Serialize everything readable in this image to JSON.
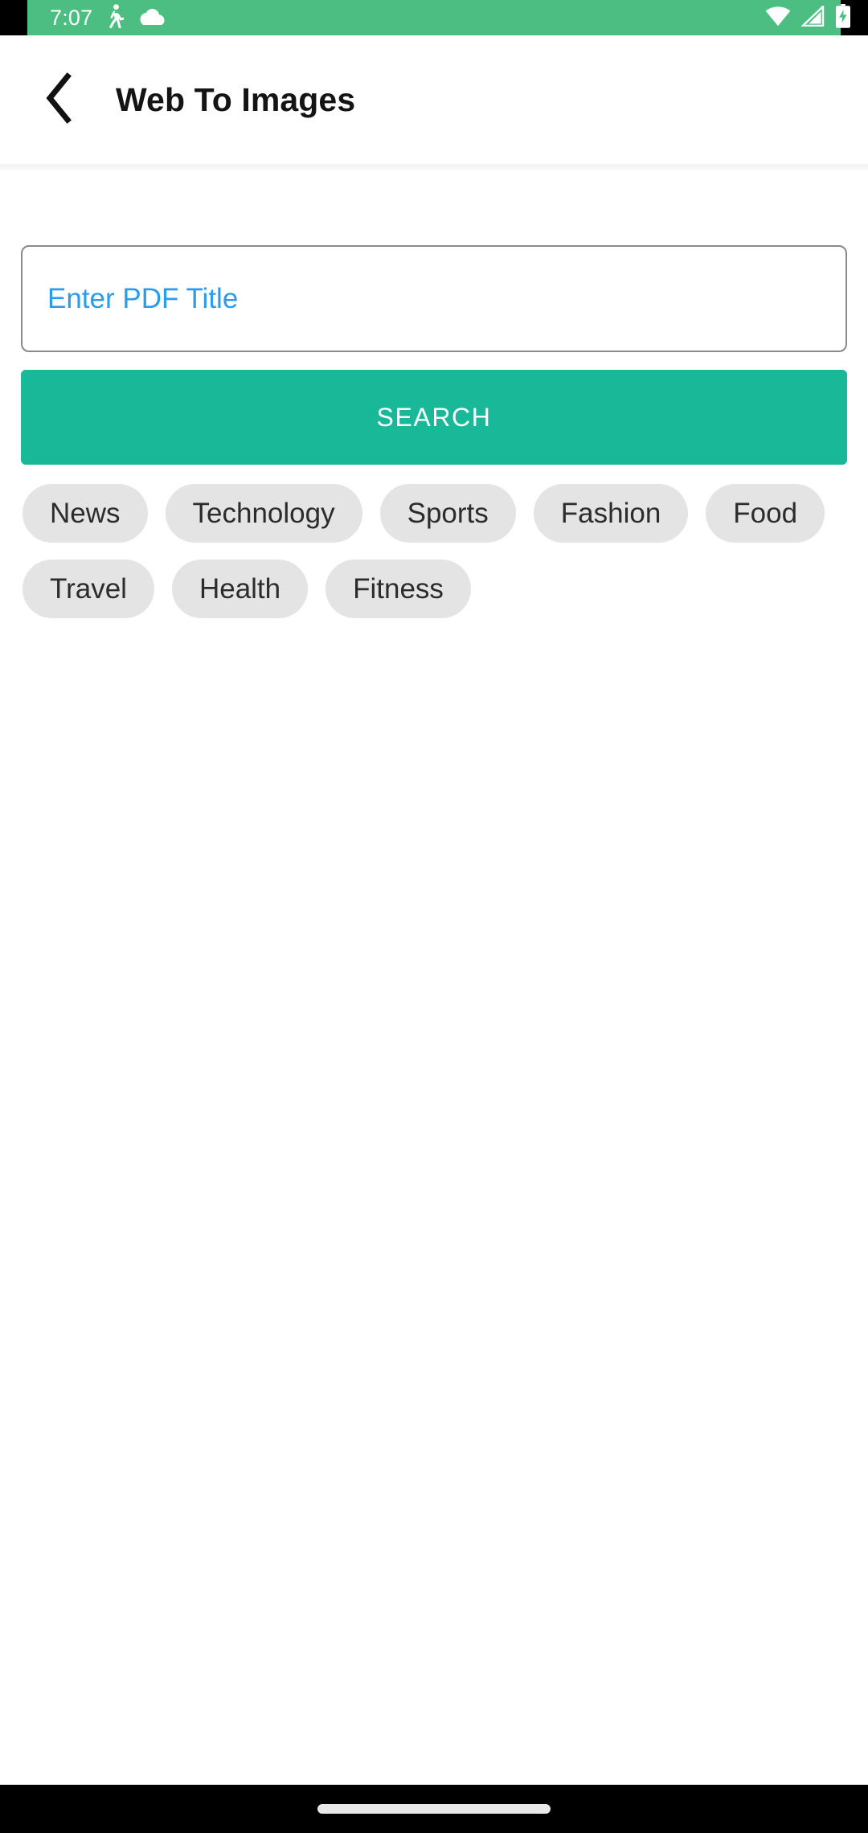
{
  "status_bar": {
    "time": "7:07",
    "background_color": "#4dbe81",
    "icons_left": [
      "walking-person-icon",
      "cloud-icon"
    ],
    "icons_right": [
      "wifi-icon",
      "cellular-signal-icon",
      "battery-charging-icon"
    ]
  },
  "app_bar": {
    "back_icon": "chevron-left-icon",
    "title": "Web To Images"
  },
  "search_form": {
    "title_input": {
      "value": "",
      "placeholder": "Enter PDF Title",
      "placeholder_color": "#2b9bf0",
      "border_color": "#8a8a8a"
    },
    "search_button": {
      "label": "SEARCH",
      "background_color": "#19b898",
      "text_color": "#ffffff"
    }
  },
  "categories": {
    "chip_background_color": "#e4e4e4",
    "chip_text_color": "#2c2c2c",
    "items": [
      {
        "label": "News"
      },
      {
        "label": "Technology"
      },
      {
        "label": "Sports"
      },
      {
        "label": "Fashion"
      },
      {
        "label": "Food"
      },
      {
        "label": "Travel"
      },
      {
        "label": "Health"
      },
      {
        "label": "Fitness"
      }
    ]
  },
  "navigation_bar": {
    "background_color": "#000000",
    "home_indicator_color": "#e8e8e8"
  }
}
